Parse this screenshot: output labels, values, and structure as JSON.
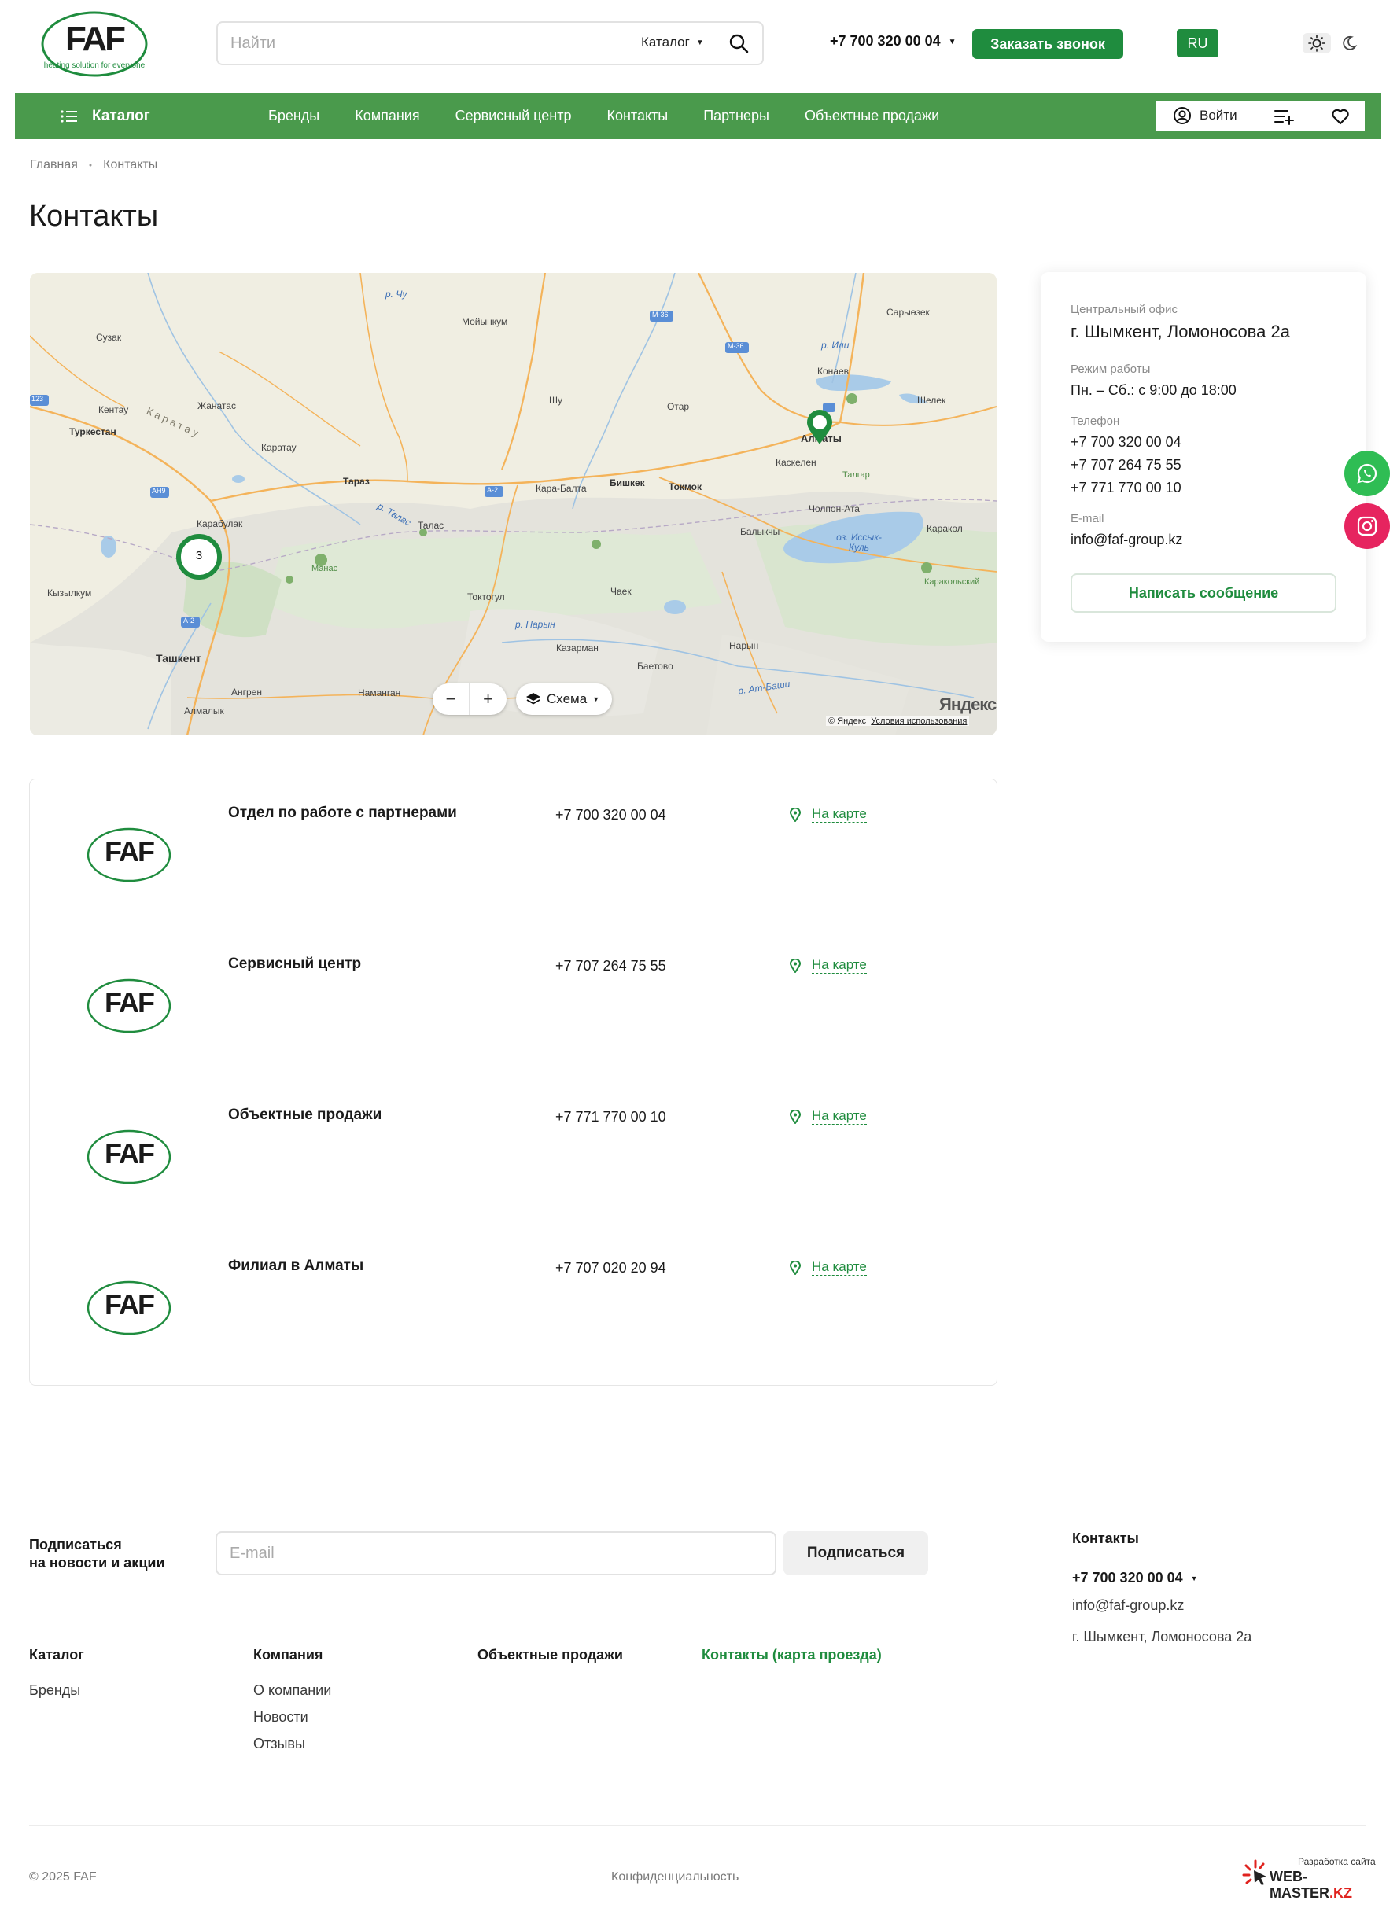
{
  "header": {
    "logo_tagline": "heating solution for everyone",
    "search_placeholder": "Найти",
    "search_scope": "Каталог",
    "phone": "+7 700 320 00 04",
    "order_call": "Заказать звонок",
    "language": "RU"
  },
  "nav": {
    "catalog": "Каталог",
    "links": [
      "Бренды",
      "Компания",
      "Сервисный центр",
      "Контакты",
      "Партнеры",
      "Объектные продажи"
    ],
    "login": "Войти"
  },
  "breadcrumb": {
    "home": "Главная",
    "current": "Контакты"
  },
  "page_title": "Контакты",
  "map": {
    "layer_mode": "Схема",
    "cluster_count": "3",
    "provider_logo": "Яндекс",
    "copyright": "© Яндекс",
    "terms": "Условия использования",
    "labels": {
      "sarykol": "Сарыөзек",
      "moiynkum": "Мойынкум",
      "suzak": "Сузак",
      "chu_river": "р. Чу",
      "ili_river": "р. Или",
      "konaev": "Конаев",
      "kentau": "Кентау",
      "zhanatas": "Жанатас",
      "shu": "Шу",
      "otar": "Отар",
      "shelek": "Шелек",
      "turkestan": "Туркестан",
      "karatau_range": "К а р а т а у",
      "karatau": "Каратау",
      "almaty": "Алматы",
      "kaskelen": "Каскелен",
      "talgar": "Талгар",
      "taraz": "Тараз",
      "kara_balta": "Кара-Балта",
      "bishkek": "Бишкек",
      "tokmok": "Токмок",
      "cholpon_ata": "Чолпон-Ата",
      "karabulak": "Карабулак",
      "talas_river": "р. Талас",
      "talas": "Талас",
      "balykchy": "Балыкчы",
      "issyk_kul": "оз. Иссык-Куль",
      "karakol": "Каракол",
      "manas": "Манас",
      "karakol_park": "Каракольский",
      "kyzylkum": "Кызылкум",
      "toktogul": "Токтогул",
      "chek": "Чаек",
      "naryn_river": "р. Нарын",
      "kazarman": "Казарман",
      "baetovo": "Баетово",
      "naryn": "Нарын",
      "tashkent": "Ташкент",
      "angren": "Ангрен",
      "namangan": "Наманган",
      "almalyk": "Алмалык",
      "at_bashy": "р. Ат-Баши",
      "m36a": "М-36",
      "m36b": "М-36",
      "a2a": "А-2",
      "a2b": "А-2",
      "ah9": "АН9",
      "r123": "123"
    }
  },
  "office": {
    "label": "Центральный офис",
    "address": "г. Шымкент, Ломоносова 2а",
    "hours_label": "Режим работы",
    "hours": "Пн. – Сб.: с 9:00 до 18:00",
    "phone_label": "Телефон",
    "phones": [
      "+7 700 320 00 04",
      "+7 707 264 75 55",
      "+7 771 770 00 10"
    ],
    "email_label": "E-mail",
    "email": "info@faf-group.kz",
    "write_button": "Написать сообщение"
  },
  "contacts": [
    {
      "name": "Отдел по работе с партнерами",
      "phone": "+7 700 320 00 04",
      "map_link": "На карте"
    },
    {
      "name": "Сервисный центр",
      "phone": "+7 707 264 75 55",
      "map_link": "На карте"
    },
    {
      "name": "Объектные продажи",
      "phone": "+7 771 770 00 10",
      "map_link": "На карте"
    },
    {
      "name": "Филиал в Алматы",
      "phone": "+7 707 020 20 94",
      "map_link": "На карте"
    }
  ],
  "footer": {
    "subscribe_label_1": "Подписаться",
    "subscribe_label_2": "на новости и акции",
    "email_placeholder": "E-mail",
    "subscribe_button": "Подписаться",
    "contacts_title": "Контакты",
    "phone": "+7 700 320 00 04",
    "email": "info@faf-group.kz",
    "address": "г. Шымкент, Ломоносова 2а",
    "col_catalog": "Каталог",
    "col_catalog_links": [
      "Бренды"
    ],
    "col_company": "Компания",
    "col_company_links": [
      "О компании",
      "Новости",
      "Отзывы"
    ],
    "col_projects": "Объектные продажи",
    "col_contacts": "Контакты (карта проезда)",
    "copyright": "© 2025 FAF",
    "privacy": "Конфиденциальность",
    "developer_line": "Разработка сайта",
    "developer_name": "WEB-MASTER",
    "developer_tld": ".KZ"
  },
  "colors": {
    "brand_green": "#1f8c3e",
    "nav_green": "#4a9a4c",
    "whatsapp": "#2fbd54",
    "instagram": "#e6245f"
  },
  "icons": [
    "search-icon",
    "chevron-down-icon",
    "sun-icon",
    "moon-icon",
    "menu-icon",
    "user-icon",
    "compare-icon",
    "heart-icon",
    "layers-icon",
    "map-pin-icon",
    "whatsapp-icon",
    "instagram-icon"
  ]
}
